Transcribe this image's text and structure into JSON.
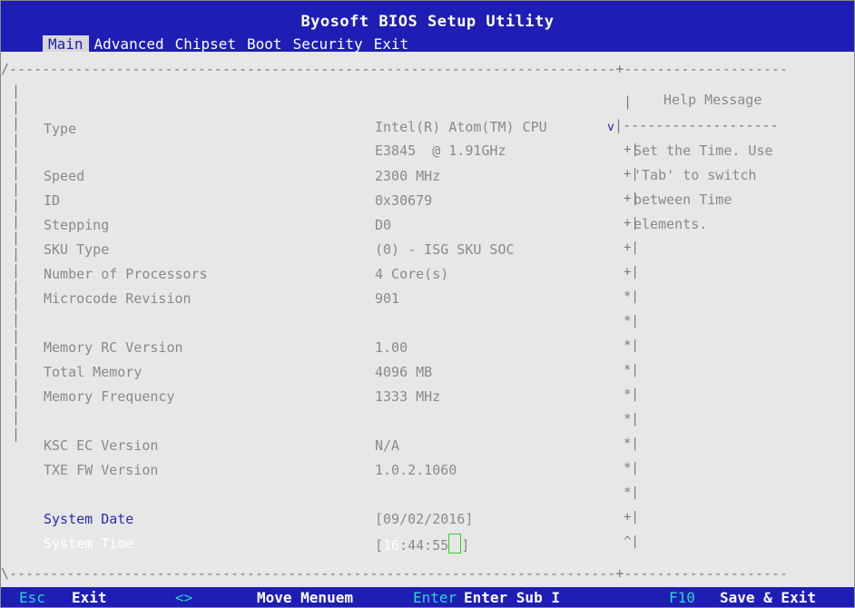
{
  "window": {
    "title": "Byosoft BIOS Setup Utility"
  },
  "menu": {
    "tabs": [
      "Main",
      "Advanced",
      "Chipset",
      "Boot",
      "Security",
      "Exit"
    ],
    "active": "Main"
  },
  "help": {
    "title": "Help Message",
    "lines": [
      "Set the Time. Use",
      "'Tab' to switch",
      "between Time",
      "elements."
    ]
  },
  "main": {
    "type_label": "Type",
    "type_value_line1": "Intel(R) Atom(TM) CPU",
    "type_value_line2": "E3845  @ 1.91GHz",
    "speed_label": "Speed",
    "speed_value": "2300 MHz",
    "id_label": "ID",
    "id_value": "0x30679",
    "stepping_label": "Stepping",
    "stepping_value": "D0",
    "sku_label": "SKU Type",
    "sku_value": "(0) - ISG SKU SOC",
    "procs_label": "Number of Processors",
    "procs_value": "4 Core(s)",
    "microcode_label": "Microcode Revision",
    "microcode_value": "901",
    "memrc_label": "Memory RC Version",
    "memrc_value": "1.00",
    "totalmem_label": "Total Memory",
    "totalmem_value": "4096 MB",
    "memfreq_label": "Memory Frequency",
    "memfreq_value": "1333 MHz",
    "ksc_label": "KSC EC Version",
    "ksc_value": "N/A",
    "txe_label": "TXE FW Version",
    "txe_value": "1.0.2.1060",
    "date_label": "System Date",
    "date_value": "[09/02/2016]",
    "time_label": "System Time",
    "time_bracket_open": "[",
    "time_hour": "16",
    "time_rest": ":44:55",
    "time_bracket_close": "]"
  },
  "footer": {
    "esc_key": "Esc",
    "esc_desc": "Exit",
    "arrows_key": "<>",
    "arrows_desc": "Move Menuem",
    "enter_key": "Enter",
    "enter_desc": "Enter Sub I",
    "f10_key": "F10",
    "f10_desc": "Save & Exit"
  },
  "colors": {
    "title_bar": "#1e1eb4",
    "panel": "#e7e7e7",
    "footer_key": "#2fd4cc",
    "cursor": "#2bd42b"
  }
}
